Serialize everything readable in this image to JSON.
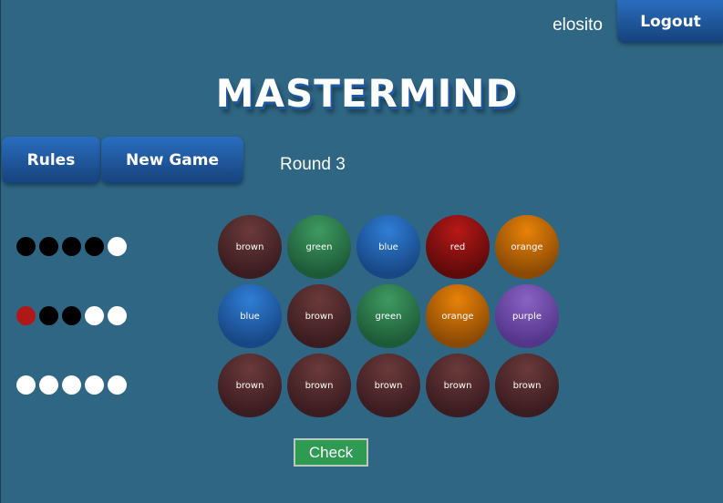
{
  "header": {
    "username": "elosito",
    "logout_label": "Logout"
  },
  "title": "MASTERMIND",
  "toolbar": {
    "rules_label": "Rules",
    "new_game_label": "New Game",
    "round_label": "Round 3"
  },
  "board": {
    "rows": [
      {
        "feedback": [
          "black",
          "black",
          "black",
          "black",
          "white"
        ],
        "balls": [
          "brown",
          "green",
          "blue",
          "red",
          "orange"
        ]
      },
      {
        "feedback": [
          "red",
          "black",
          "black",
          "white",
          "white"
        ],
        "balls": [
          "blue",
          "brown",
          "green",
          "orange",
          "purple"
        ]
      },
      {
        "feedback": [
          "white",
          "white",
          "white",
          "white",
          "white"
        ],
        "balls": [
          "brown",
          "brown",
          "brown",
          "brown",
          "brown"
        ]
      }
    ]
  },
  "check_label": "Check",
  "colors": {
    "background": "#2f6683",
    "button_blue": "#1f5ca8",
    "check_green": "#2e9a52"
  }
}
